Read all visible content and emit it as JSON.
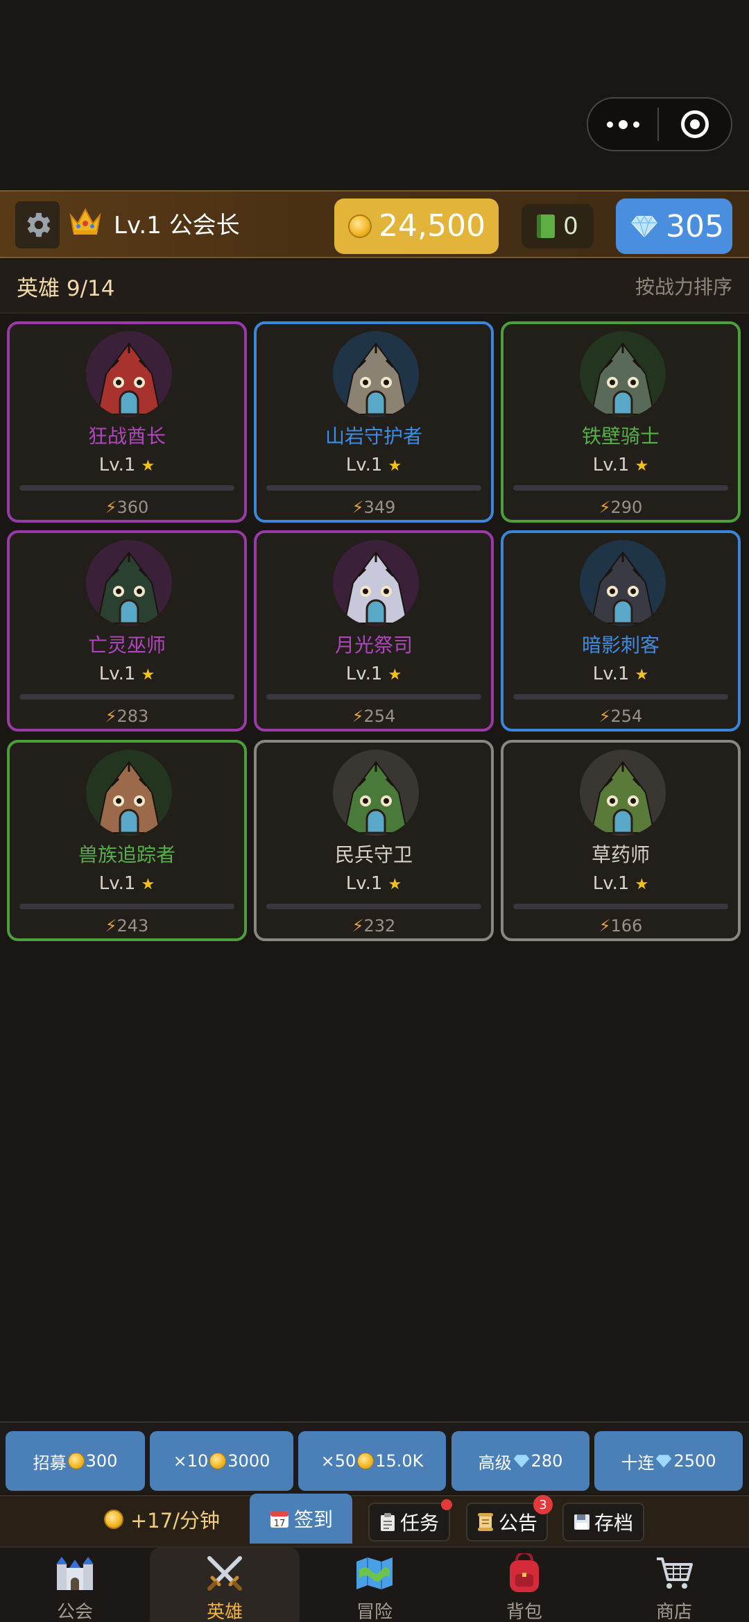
{
  "topbar": {
    "player_level": "Lv.1 公会长",
    "gold": "24,500",
    "books": "0",
    "gems": "305"
  },
  "heroes_header": {
    "title": "英雄 9/14",
    "sort_label": "按战力排序"
  },
  "heroes": [
    {
      "name": "狂战酋长",
      "level": "Lv.1",
      "star": "★",
      "power": "360",
      "rarity": "purple"
    },
    {
      "name": "山岩守护者",
      "level": "Lv.1",
      "star": "★",
      "power": "349",
      "rarity": "blue"
    },
    {
      "name": "铁壁骑士",
      "level": "Lv.1",
      "star": "★",
      "power": "290",
      "rarity": "green"
    },
    {
      "name": "亡灵巫师",
      "level": "Lv.1",
      "star": "★",
      "power": "283",
      "rarity": "purple"
    },
    {
      "name": "月光祭司",
      "level": "Lv.1",
      "star": "★",
      "power": "254",
      "rarity": "purple"
    },
    {
      "name": "暗影刺客",
      "level": "Lv.1",
      "star": "★",
      "power": "254",
      "rarity": "blue"
    },
    {
      "name": "兽族追踪者",
      "level": "Lv.1",
      "star": "★",
      "power": "243",
      "rarity": "green"
    },
    {
      "name": "民兵守卫",
      "level": "Lv.1",
      "star": "★",
      "power": "232",
      "rarity": "gray"
    },
    {
      "name": "草药师",
      "level": "Lv.1",
      "star": "★",
      "power": "166",
      "rarity": "gray"
    }
  ],
  "recruit": [
    {
      "prefix": "招募",
      "currency": "coin",
      "cost": "300"
    },
    {
      "prefix": "×10",
      "currency": "coin",
      "cost": "3000"
    },
    {
      "prefix": "×50",
      "currency": "coin",
      "cost": "15.0K"
    },
    {
      "prefix": "高级",
      "currency": "gem",
      "cost": "280"
    },
    {
      "prefix": "十连",
      "currency": "gem",
      "cost": "2500"
    }
  ],
  "actions": {
    "income": "+17/分钟",
    "checkin": "签到",
    "checkin_date": "17",
    "tasks": "任务",
    "notice": "公告",
    "notice_badge": "3",
    "save": "存档"
  },
  "nav": [
    {
      "label": "公会",
      "icon": "castle-icon"
    },
    {
      "label": "英雄",
      "icon": "crossed-swords-icon"
    },
    {
      "label": "冒险",
      "icon": "map-icon"
    },
    {
      "label": "背包",
      "icon": "backpack-icon"
    },
    {
      "label": "商店",
      "icon": "cart-icon"
    }
  ],
  "colors": {
    "purple": "#9a3aa8",
    "blue": "#3a86d8",
    "green": "#4ca03a",
    "gray": "#8a8680",
    "gold": "#e2b43a",
    "gem": "#4a8ee0",
    "active_nav": "#f2b43a"
  }
}
